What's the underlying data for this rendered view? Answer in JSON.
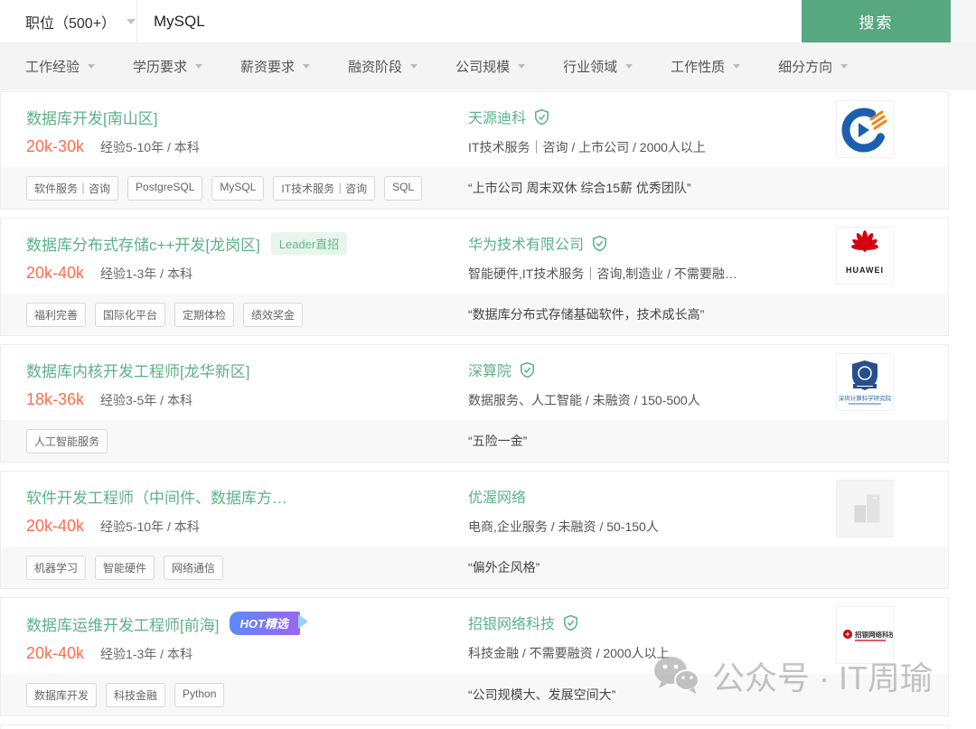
{
  "search_bar": {
    "category_label": "职位（500+）",
    "query": "MySQL",
    "search_label": "搜索"
  },
  "filters": [
    "工作经验",
    "学历要求",
    "薪资要求",
    "融资阶段",
    "公司规模",
    "行业领域",
    "工作性质",
    "细分方向"
  ],
  "accent_colors": {
    "green": "#5cb287",
    "orange": "#ff6c4a",
    "button_green": "#57a880"
  },
  "jobs": [
    {
      "title": "数据库开发[南山区]",
      "badge": null,
      "salary": "20k-30k",
      "meta": "经验5-10年 / 本科",
      "tags": [
        "软件服务｜咨询",
        "PostgreSQL",
        "MySQL",
        "IT技术服务｜咨询",
        "SQL"
      ],
      "company": "天源迪科",
      "verified": true,
      "info": "IT技术服务｜咨询 / 上市公司 / 2000人以上",
      "quote": "“上市公司 周末双休 综合15薪 优秀团队”",
      "logo": {
        "kind": "tianyuan",
        "text": ""
      }
    },
    {
      "title": "数据库分布式存储c++开发[龙岗区]",
      "badge": {
        "type": "leader",
        "text": "Leader直招"
      },
      "salary": "20k-40k",
      "meta": "经验1-3年 / 本科",
      "tags": [
        "福利完善",
        "国际化平台",
        "定期体检",
        "绩效奖金"
      ],
      "company": "华为技术有限公司",
      "verified": true,
      "info": "智能硬件,IT技术服务｜咨询,制造业 / 不需要融…",
      "quote": "“数据库分布式存储基础软件，技术成长高”",
      "logo": {
        "kind": "huawei",
        "text": "HUAWEI"
      }
    },
    {
      "title": "数据库内核开发工程师[龙华新区]",
      "badge": null,
      "salary": "18k-36k",
      "meta": "经验3-5年 / 本科",
      "tags": [
        "人工智能服务"
      ],
      "company": "深算院",
      "verified": true,
      "info": "数据服务、人工智能 / 未融资 / 150-500人",
      "quote": "“五险一金”",
      "logo": {
        "kind": "sics",
        "text": "深圳计算科学研究院"
      }
    },
    {
      "title": "软件开发工程师（中间件、数据库方…",
      "badge": null,
      "salary": "20k-40k",
      "meta": "经验5-10年 / 本科",
      "tags": [
        "机器学习",
        "智能硬件",
        "网络通信"
      ],
      "company": "优渥网络",
      "verified": false,
      "info": "电商,企业服务 / 未融资 / 50-150人",
      "quote": "“偏外企风格”",
      "logo": {
        "kind": "placeholder",
        "text": ""
      }
    },
    {
      "title": "数据库运维开发工程师[前海]",
      "badge": {
        "type": "hot",
        "text": "HOT精选"
      },
      "salary": "20k-40k",
      "meta": "经验1-3年 / 本科",
      "tags": [
        "数据库开发",
        "科技金融",
        "Python"
      ],
      "company": "招银网络科技",
      "verified": true,
      "info": "科技金融 / 不需要融资 / 2000人以上",
      "quote": "“公司规模大、发展空间大”",
      "logo": {
        "kind": "cmb",
        "text": "招银网络科技"
      }
    }
  ],
  "watermark": {
    "text": "公众号 · IT周瑜"
  }
}
